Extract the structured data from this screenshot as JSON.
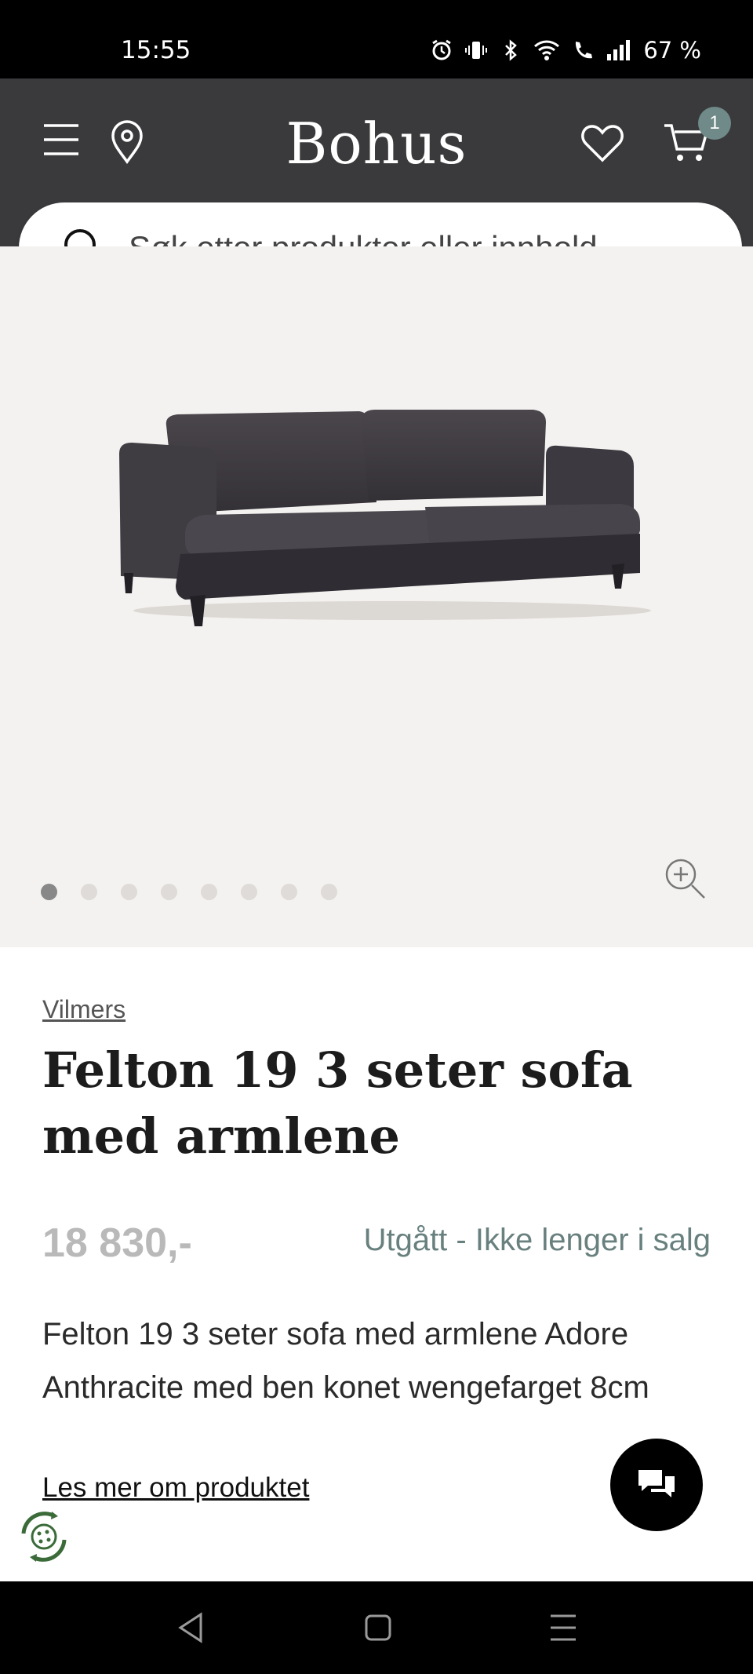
{
  "status_bar": {
    "time": "15:55",
    "battery_text": "67 %",
    "icons": [
      "alarm-icon",
      "vibrate-icon",
      "bluetooth-icon",
      "wifi-icon",
      "call-icon",
      "signal-icon"
    ]
  },
  "header": {
    "logo": "Bohus",
    "cart_count": "1",
    "icons": [
      "menu-icon",
      "location-pin-icon",
      "heart-icon",
      "cart-icon"
    ],
    "background_color": "#3a393b"
  },
  "search": {
    "placeholder": "Søk etter produkter eller innhold..."
  },
  "gallery": {
    "image_count": 8,
    "active_index": 0
  },
  "product": {
    "brand": "Vilmers",
    "title": "Felton 19 3 seter sofa med armlene",
    "price": "18 830,-",
    "availability": "Utgått - Ikke lenger i salg",
    "description": "Felton 19 3 seter sofa med armlene Adore Anthracite med ben konet wengefarget 8cm",
    "read_more": "Les mer om produktet"
  },
  "colors": {
    "accent": "#6f8a88",
    "availability": "#68807e",
    "price": "#b9b9b9"
  }
}
